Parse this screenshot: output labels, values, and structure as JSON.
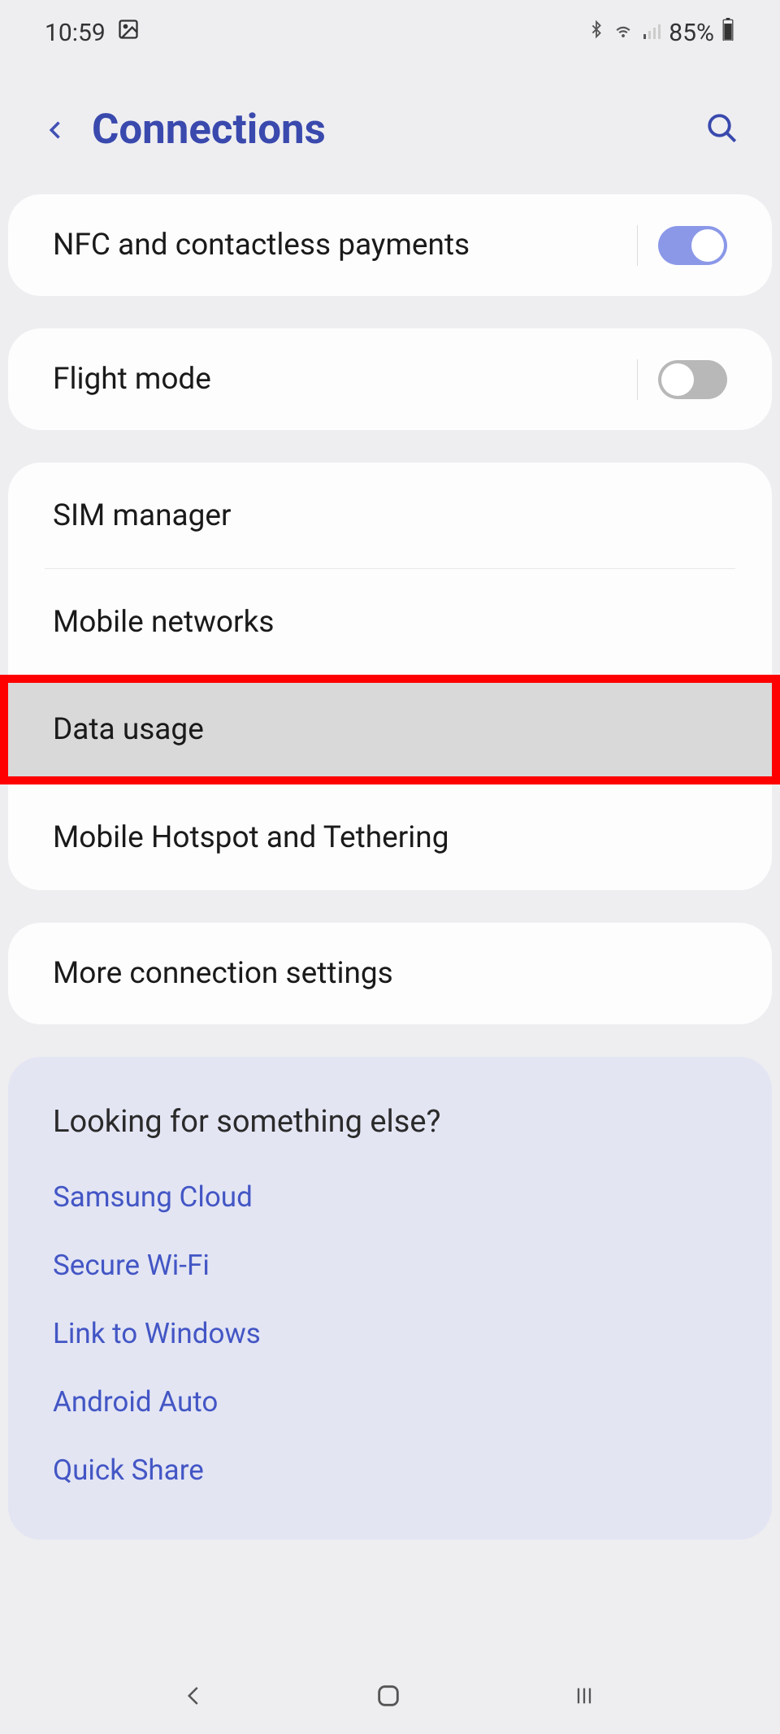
{
  "status": {
    "time": "10:59",
    "battery": "85%"
  },
  "header": {
    "title": "Connections"
  },
  "rows": {
    "nfc": "NFC and contactless payments",
    "flight": "Flight mode",
    "sim": "SIM manager",
    "mobile_net": "Mobile networks",
    "data_usage": "Data usage",
    "hotspot": "Mobile Hotspot and Tethering",
    "more": "More connection settings"
  },
  "suggestions": {
    "title": "Looking for something else?",
    "links": {
      "samsung_cloud": "Samsung Cloud",
      "secure_wifi": "Secure Wi-Fi",
      "link_windows": "Link to Windows",
      "android_auto": "Android Auto",
      "quick_share": "Quick Share"
    }
  }
}
